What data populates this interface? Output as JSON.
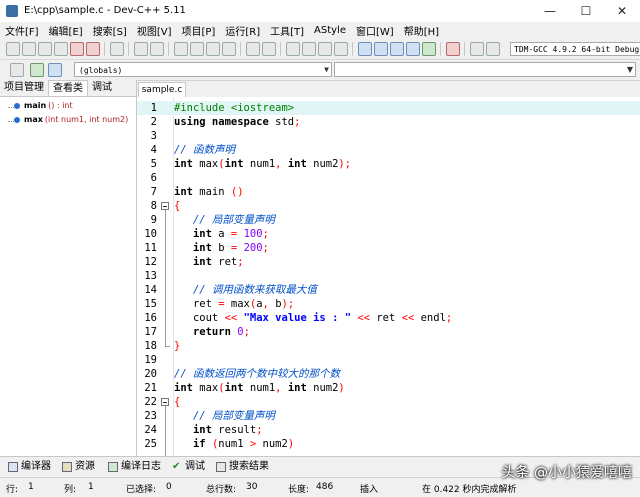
{
  "window": {
    "title": "E:\\cpp\\sample.c - Dev-C++ 5.11",
    "minimize": "—",
    "maximize": "☐",
    "close": "✕"
  },
  "menu": [
    "文件[F]",
    "编辑[E]",
    "搜索[S]",
    "视图[V]",
    "项目[P]",
    "运行[R]",
    "工具[T]",
    "AStyle",
    "窗口[W]",
    "帮助[H]"
  ],
  "toolbar": {
    "compiler": "TDM-GCC 4.9.2 64-bit Debug"
  },
  "scope": {
    "value": "(globals)"
  },
  "left_panel": {
    "tabs": [
      "项目管理",
      "查看类",
      "调试"
    ],
    "symbols": [
      {
        "name": "main",
        "sig": "() : int"
      },
      {
        "name": "max",
        "sig": "(int num1, int num2)"
      }
    ]
  },
  "editor": {
    "tab": "sample.c",
    "lines": [
      {
        "n": "1",
        "t": [
          [
            "pp",
            "#include <iostream>"
          ]
        ]
      },
      {
        "n": "2",
        "t": [
          [
            "kw",
            "using namespace"
          ],
          [
            "plain",
            " std"
          ],
          [
            "op",
            ";"
          ]
        ]
      },
      {
        "n": "3",
        "t": []
      },
      {
        "n": "4",
        "t": [
          [
            "cm",
            "// 函数声明"
          ]
        ]
      },
      {
        "n": "5",
        "t": [
          [
            "kw",
            "int"
          ],
          [
            "plain",
            " max"
          ],
          [
            "op",
            "("
          ],
          [
            "kw",
            "int"
          ],
          [
            "plain",
            " num1"
          ],
          [
            "op",
            ","
          ],
          [
            "plain",
            " "
          ],
          [
            "kw",
            "int"
          ],
          [
            "plain",
            " num2"
          ],
          [
            "op",
            ");"
          ]
        ]
      },
      {
        "n": "6",
        "t": []
      },
      {
        "n": "7",
        "t": [
          [
            "kw",
            "int"
          ],
          [
            "plain",
            " main "
          ],
          [
            "op",
            "()"
          ]
        ]
      },
      {
        "n": "8",
        "t": [
          [
            "op",
            "{"
          ]
        ]
      },
      {
        "n": "9",
        "t": [
          [
            "plain",
            "   "
          ],
          [
            "cm",
            "// 局部变量声明"
          ]
        ]
      },
      {
        "n": "10",
        "t": [
          [
            "plain",
            "   "
          ],
          [
            "kw",
            "int"
          ],
          [
            "plain",
            " a "
          ],
          [
            "op",
            "="
          ],
          [
            "plain",
            " "
          ],
          [
            "num",
            "100"
          ],
          [
            "op",
            ";"
          ]
        ]
      },
      {
        "n": "11",
        "t": [
          [
            "plain",
            "   "
          ],
          [
            "kw",
            "int"
          ],
          [
            "plain",
            " b "
          ],
          [
            "op",
            "="
          ],
          [
            "plain",
            " "
          ],
          [
            "num",
            "200"
          ],
          [
            "op",
            ";"
          ]
        ]
      },
      {
        "n": "12",
        "t": [
          [
            "plain",
            "   "
          ],
          [
            "kw",
            "int"
          ],
          [
            "plain",
            " ret"
          ],
          [
            "op",
            ";"
          ]
        ]
      },
      {
        "n": "13",
        "t": []
      },
      {
        "n": "14",
        "t": [
          [
            "plain",
            "   "
          ],
          [
            "cm",
            "// 调用函数来获取最大值"
          ]
        ]
      },
      {
        "n": "15",
        "t": [
          [
            "plain",
            "   ret "
          ],
          [
            "op",
            "="
          ],
          [
            "plain",
            " max"
          ],
          [
            "op",
            "("
          ],
          [
            "plain",
            "a"
          ],
          [
            "op",
            ","
          ],
          [
            "plain",
            " b"
          ],
          [
            "op",
            ");"
          ]
        ]
      },
      {
        "n": "16",
        "t": [
          [
            "plain",
            "   cout "
          ],
          [
            "op",
            "<<"
          ],
          [
            "plain",
            " "
          ],
          [
            "str",
            "\"Max value is : \""
          ],
          [
            "plain",
            " "
          ],
          [
            "op",
            "<<"
          ],
          [
            "plain",
            " ret "
          ],
          [
            "op",
            "<<"
          ],
          [
            "plain",
            " endl"
          ],
          [
            "op",
            ";"
          ]
        ]
      },
      {
        "n": "17",
        "t": [
          [
            "plain",
            "   "
          ],
          [
            "kw",
            "return"
          ],
          [
            "plain",
            " "
          ],
          [
            "num",
            "0"
          ],
          [
            "op",
            ";"
          ]
        ]
      },
      {
        "n": "18",
        "t": [
          [
            "op",
            "}"
          ]
        ]
      },
      {
        "n": "19",
        "t": []
      },
      {
        "n": "20",
        "t": [
          [
            "cm",
            "// 函数返回两个数中较大的那个数"
          ]
        ]
      },
      {
        "n": "21",
        "t": [
          [
            "kw",
            "int"
          ],
          [
            "plain",
            " max"
          ],
          [
            "op",
            "("
          ],
          [
            "kw",
            "int"
          ],
          [
            "plain",
            " num1"
          ],
          [
            "op",
            ","
          ],
          [
            "plain",
            " "
          ],
          [
            "kw",
            "int"
          ],
          [
            "plain",
            " num2"
          ],
          [
            "op",
            ")"
          ]
        ]
      },
      {
        "n": "22",
        "t": [
          [
            "op",
            "{"
          ]
        ]
      },
      {
        "n": "23",
        "t": [
          [
            "plain",
            "   "
          ],
          [
            "cm",
            "// 局部变量声明"
          ]
        ]
      },
      {
        "n": "24",
        "t": [
          [
            "plain",
            "   "
          ],
          [
            "kw",
            "int"
          ],
          [
            "plain",
            " result"
          ],
          [
            "op",
            ";"
          ]
        ]
      },
      {
        "n": "25",
        "t": [
          [
            "plain",
            "   "
          ],
          [
            "kw",
            "if"
          ],
          [
            "plain",
            " "
          ],
          [
            "op",
            "("
          ],
          [
            "plain",
            "num1 "
          ],
          [
            "op",
            ">"
          ],
          [
            "plain",
            " num2"
          ],
          [
            "op",
            ")"
          ]
        ]
      }
    ]
  },
  "bottom_tabs": [
    "编译器",
    "资源",
    "编译日志",
    "调试",
    "搜索结果"
  ],
  "status": {
    "row_label": "行:",
    "row_value": "1",
    "col_label": "列:",
    "col_value": "1",
    "sel_label": "已选择:",
    "sel_value": "0",
    "total_label": "总行数:",
    "total_value": "30",
    "len_label": "长度:",
    "len_value": "486",
    "mode": "插入",
    "parse": "在 0.422 秒内完成解析"
  },
  "watermark": "头条 @小小猿爱嘻嘻"
}
